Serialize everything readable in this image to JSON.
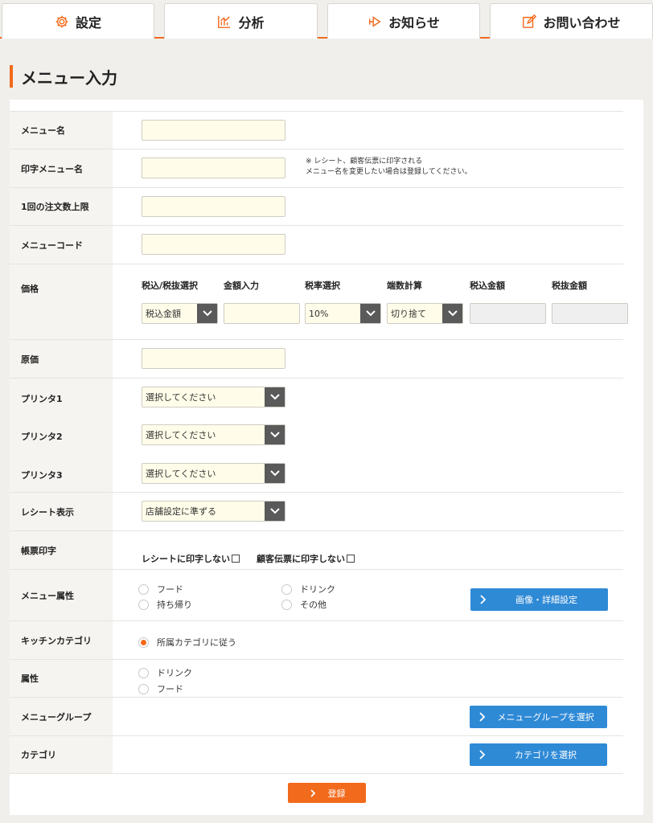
{
  "nav": {
    "settings": "設定",
    "analysis": "分析",
    "notice": "お知らせ",
    "contact": "お問い合わせ"
  },
  "colors": {
    "accent": "#f26a1b",
    "blue_button": "#2f8ad6",
    "input_bg": "#fffde9"
  },
  "page_title": "メニュー入力",
  "form": {
    "menu_name": {
      "label": "メニュー名",
      "value": ""
    },
    "print_menu_name": {
      "label": "印字メニュー名",
      "value": "",
      "note_line1": "※ レシート、顧客伝票に印字される",
      "note_line2": "メニュー名を変更したい場合は登録してください。"
    },
    "order_limit": {
      "label": "1回の注文数上限",
      "value": ""
    },
    "menu_code": {
      "label": "メニューコード",
      "value": ""
    },
    "price": {
      "label": "価格",
      "headers": [
        "税込/税抜選択",
        "金額入力",
        "税率選択",
        "端数計算",
        "税込金額",
        "税抜金額"
      ],
      "tax_type": "税込金額",
      "amount": "",
      "tax_rate": "10%",
      "rounding": "切り捨て",
      "tax_included": "",
      "tax_excluded": ""
    },
    "cost": {
      "label": "原価",
      "value": ""
    },
    "printer1": {
      "label": "プリンタ1",
      "value": "選択してください"
    },
    "printer2": {
      "label": "プリンタ2",
      "value": "選択してください"
    },
    "printer3": {
      "label": "プリンタ3",
      "value": "選択してください"
    },
    "receipt_display": {
      "label": "レシート表示",
      "value": "店舗設定に準ずる"
    },
    "slip_print": {
      "label": "帳票印字",
      "no_receipt": "レシートに印字しない",
      "no_customer_slip": "顧客伝票に印字しない"
    },
    "menu_attr": {
      "label": "メニュー属性",
      "options": [
        "フード",
        "ドリンク",
        "持ち帰り",
        "その他"
      ],
      "button": "画像・詳細設定"
    },
    "kitchen_category": {
      "label": "キッチンカテゴリ",
      "option": "所属カテゴリに従う"
    },
    "attribute": {
      "label": "属性",
      "options": [
        "ドリンク",
        "フード"
      ]
    },
    "menu_group": {
      "label": "メニューグループ",
      "button": "メニューグループを選択"
    },
    "category": {
      "label": "カテゴリ",
      "button": "カテゴリを選択"
    },
    "submit": "登録"
  }
}
